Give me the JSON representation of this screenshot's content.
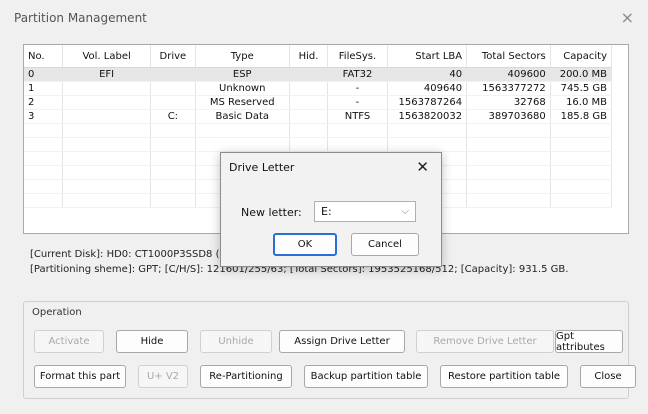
{
  "window": {
    "title": "Partition Management",
    "close_icon": "×"
  },
  "table": {
    "headers": [
      "No.",
      "Vol. Label",
      "Drive",
      "Type",
      "Hid.",
      "FileSys.",
      "Start LBA",
      "Total Sectors",
      "Capacity"
    ],
    "rows": [
      [
        "0",
        "EFI",
        "",
        "ESP",
        "",
        "FAT32",
        "40",
        "409600",
        "200.0 MB"
      ],
      [
        "1",
        "",
        "",
        "Unknown",
        "",
        "-",
        "409640",
        "1563377272",
        "745.5 GB"
      ],
      [
        "2",
        "",
        "",
        "MS Reserved",
        "",
        "-",
        "1563787264",
        "32768",
        "16.0 MB"
      ],
      [
        "3",
        "",
        "C:",
        "Basic Data",
        "",
        "NTFS",
        "1563820032",
        "389703680",
        "185.8 GB"
      ]
    ],
    "empty_rows": 6
  },
  "info": {
    "current_disk": "[Current Disk]:   HD0: CT1000P3SSD8 (931.5GB, Crtc.)",
    "partitioning": "[Partitioning sheme]:    GPT;     [C/H/S]: 121601/255/63; [Total Sectors]: 1953525168/512; [Capacity]: 931.5 GB."
  },
  "operation": {
    "label": "Operation",
    "row1": [
      {
        "label": "Activate",
        "enabled": false
      },
      {
        "label": "Hide",
        "enabled": true
      },
      {
        "label": "Unhide",
        "enabled": false
      },
      {
        "label": "Assign Drive Letter",
        "enabled": true
      },
      {
        "label": "Remove Drive Letter",
        "enabled": false
      },
      {
        "label": "Gpt attributes",
        "enabled": true
      }
    ],
    "row2": [
      {
        "label": "Format this part",
        "enabled": true
      },
      {
        "label": "U+ V2",
        "enabled": false
      },
      {
        "label": "Re-Partitioning",
        "enabled": true
      },
      {
        "label": "Backup partition table",
        "enabled": true
      },
      {
        "label": "Restore partition table",
        "enabled": true
      },
      {
        "label": "Close",
        "enabled": true
      }
    ]
  },
  "dialog": {
    "title": "Drive Letter",
    "close_icon": "✕",
    "new_letter_label": "New letter:",
    "selected_letter": "E:",
    "chevron": "⌵",
    "ok": "OK",
    "cancel": "Cancel"
  }
}
